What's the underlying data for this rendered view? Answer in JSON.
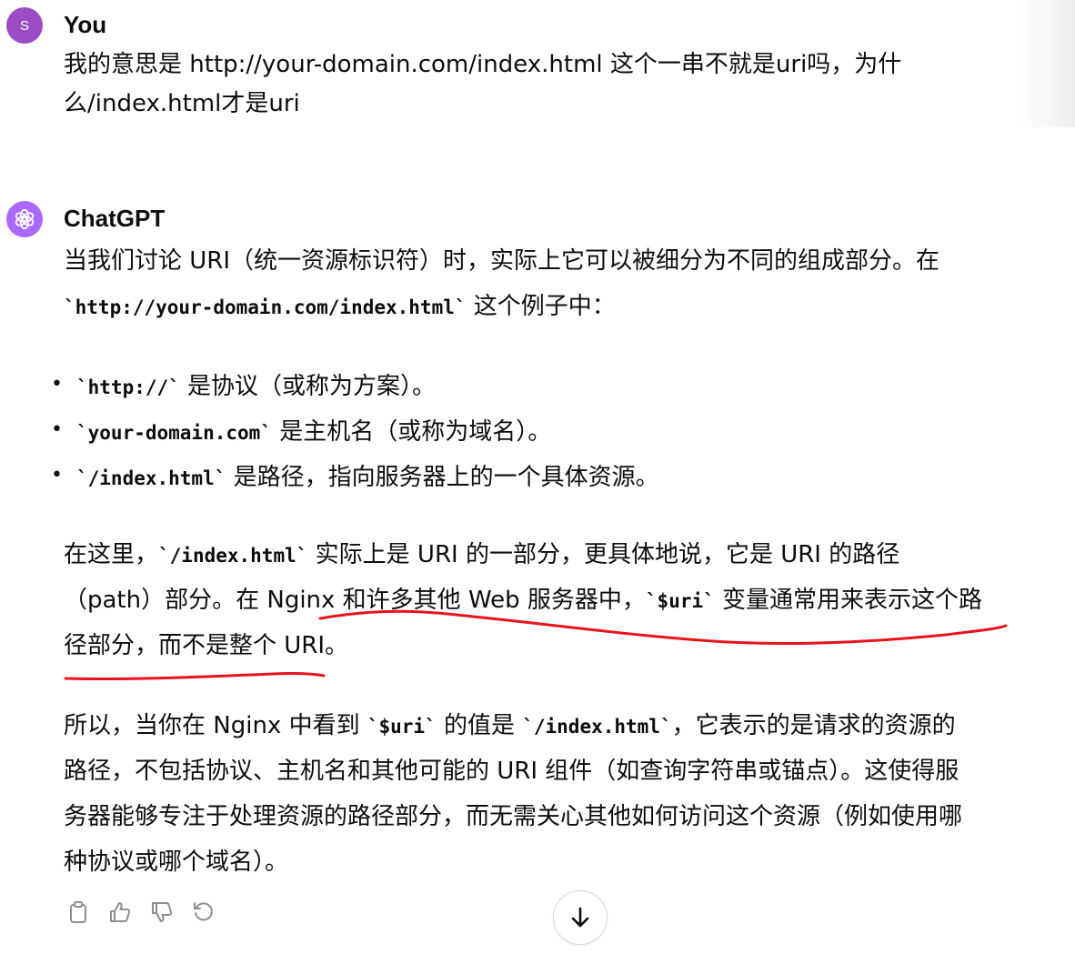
{
  "user_message": {
    "avatar_letter": "S",
    "author": "You",
    "lines": [
      "我的意思是 http://your-domain.com/index.html  这个一串不就是uri吗，为什",
      "么/index.html才是uri"
    ]
  },
  "assistant_message": {
    "author": "ChatGPT",
    "intro": {
      "line1": "当我们讨论 URI（统一资源标识符）时，实际上它可以被细分为不同的组成部分。在",
      "line2_code": "`http://your-domain.com/index.html`",
      "line2_text": " 这个例子中："
    },
    "bullets": [
      {
        "code": "`http://`",
        "text": " 是协议（或称为方案）。"
      },
      {
        "code": "`your-domain.com`",
        "text": " 是主机名（或称为域名）。"
      },
      {
        "code": "`/index.html`",
        "text": " 是路径，指向服务器上的一个具体资源。"
      }
    ],
    "para2": {
      "l1_a": "在这里，",
      "l1_code": "`/index.html`",
      "l1_b": " 实际上是 URI 的一部分，更具体地说，它是 URI 的路径",
      "l2_a": "（path）部分。在 Nginx 和许多其他 Web 服务器中，",
      "l2_code": "`$uri`",
      "l2_b": " 变量通常用来表示这个路",
      "l3": "径部分，而不是整个 URI。"
    },
    "para3": {
      "l1_a": "所以，当你在 Nginx 中看到 ",
      "l1_code1": "`$uri`",
      "l1_b": " 的值是 ",
      "l1_code2": "`/index.html`",
      "l1_c": "，它表示的是请求的资源的",
      "l2": "路径，不包括协议、主机名和其他可能的 URI 组件（如查询字符串或锚点）。这使得服",
      "l3": "务器能够专注于处理资源的路径部分，而无需关心其他如何访问这个资源（例如使用哪",
      "l4": "种协议或哪个域名）。"
    }
  },
  "actions": {
    "icons": [
      "copy-icon",
      "thumbs-up-icon",
      "thumbs-down-icon",
      "regenerate-icon"
    ]
  },
  "colors": {
    "user_avatar": "#9c4dc4",
    "gpt_avatar": "#ab68ff",
    "annotation": "#e8141c"
  }
}
